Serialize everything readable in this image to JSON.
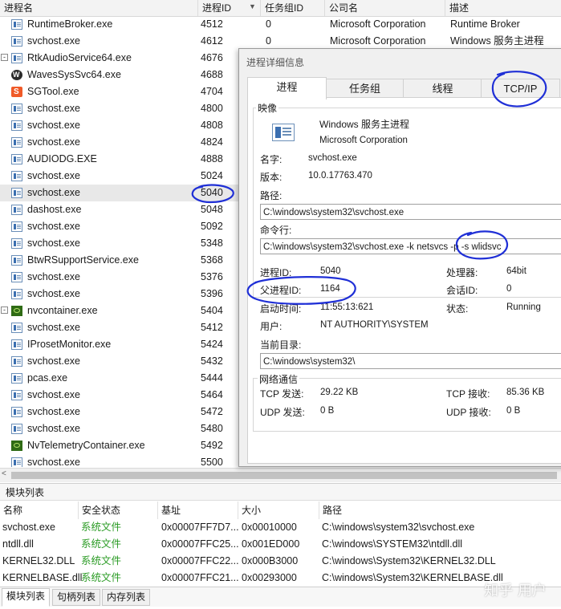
{
  "process_table": {
    "columns": [
      "进程名",
      "进程ID",
      "任务组ID",
      "公司名",
      "描述"
    ],
    "rows": [
      {
        "name": "RuntimeBroker.exe",
        "pid": "4512",
        "jid": "0",
        "company": "Microsoft Corporation",
        "desc": "Runtime Broker",
        "icon": "generic-exe-icon",
        "expand": ""
      },
      {
        "name": "svchost.exe",
        "pid": "4612",
        "jid": "0",
        "company": "Microsoft Corporation",
        "desc": "Windows 服务主进程",
        "icon": "generic-exe-icon",
        "expand": ""
      },
      {
        "name": "RtkAudioService64.exe",
        "pid": "4676",
        "jid": "",
        "company": "",
        "desc": "",
        "icon": "generic-exe-icon",
        "expand": "-"
      },
      {
        "name": "WavesSysSvc64.exe",
        "pid": "4688",
        "jid": "",
        "company": "",
        "desc": "",
        "icon": "waves-icon",
        "expand": ""
      },
      {
        "name": "SGTool.exe",
        "pid": "4704",
        "jid": "",
        "company": "",
        "desc": "",
        "icon": "sogou-icon",
        "expand": ""
      },
      {
        "name": "svchost.exe",
        "pid": "4800",
        "jid": "",
        "company": "",
        "desc": "",
        "icon": "generic-exe-icon",
        "expand": ""
      },
      {
        "name": "svchost.exe",
        "pid": "4808",
        "jid": "",
        "company": "",
        "desc": "",
        "icon": "generic-exe-icon",
        "expand": ""
      },
      {
        "name": "svchost.exe",
        "pid": "4824",
        "jid": "",
        "company": "",
        "desc": "",
        "icon": "generic-exe-icon",
        "expand": ""
      },
      {
        "name": "AUDIODG.EXE",
        "pid": "4888",
        "jid": "",
        "company": "",
        "desc": "",
        "icon": "generic-exe-icon",
        "expand": ""
      },
      {
        "name": "svchost.exe",
        "pid": "5024",
        "jid": "",
        "company": "",
        "desc": "",
        "icon": "generic-exe-icon",
        "expand": ""
      },
      {
        "name": "svchost.exe",
        "pid": "5040",
        "jid": "",
        "company": "",
        "desc": "",
        "icon": "generic-exe-icon",
        "expand": "",
        "selected": true
      },
      {
        "name": "dashost.exe",
        "pid": "5048",
        "jid": "",
        "company": "",
        "desc": "",
        "icon": "generic-exe-icon",
        "expand": ""
      },
      {
        "name": "svchost.exe",
        "pid": "5092",
        "jid": "",
        "company": "",
        "desc": "",
        "icon": "generic-exe-icon",
        "expand": ""
      },
      {
        "name": "svchost.exe",
        "pid": "5348",
        "jid": "",
        "company": "",
        "desc": "",
        "icon": "generic-exe-icon",
        "expand": ""
      },
      {
        "name": "BtwRSupportService.exe",
        "pid": "5368",
        "jid": "",
        "company": "",
        "desc": "",
        "icon": "generic-exe-icon",
        "expand": ""
      },
      {
        "name": "svchost.exe",
        "pid": "5376",
        "jid": "",
        "company": "",
        "desc": "",
        "icon": "generic-exe-icon",
        "expand": ""
      },
      {
        "name": "svchost.exe",
        "pid": "5396",
        "jid": "",
        "company": "",
        "desc": "",
        "icon": "generic-exe-icon",
        "expand": ""
      },
      {
        "name": "nvcontainer.exe",
        "pid": "5404",
        "jid": "",
        "company": "",
        "desc": "",
        "icon": "nvidia-icon",
        "expand": "-"
      },
      {
        "name": "svchost.exe",
        "pid": "5412",
        "jid": "",
        "company": "",
        "desc": "",
        "icon": "generic-exe-icon",
        "expand": ""
      },
      {
        "name": "IProsetMonitor.exe",
        "pid": "5424",
        "jid": "",
        "company": "",
        "desc": "",
        "icon": "generic-exe-icon",
        "expand": ""
      },
      {
        "name": "svchost.exe",
        "pid": "5432",
        "jid": "",
        "company": "",
        "desc": "",
        "icon": "generic-exe-icon",
        "expand": ""
      },
      {
        "name": "pcas.exe",
        "pid": "5444",
        "jid": "",
        "company": "",
        "desc": "",
        "icon": "generic-exe-icon",
        "expand": ""
      },
      {
        "name": "svchost.exe",
        "pid": "5464",
        "jid": "",
        "company": "",
        "desc": "",
        "icon": "generic-exe-icon",
        "expand": ""
      },
      {
        "name": "svchost.exe",
        "pid": "5472",
        "jid": "",
        "company": "",
        "desc": "",
        "icon": "generic-exe-icon",
        "expand": ""
      },
      {
        "name": "svchost.exe",
        "pid": "5480",
        "jid": "",
        "company": "",
        "desc": "",
        "icon": "generic-exe-icon",
        "expand": ""
      },
      {
        "name": "NvTelemetryContainer.exe",
        "pid": "5492",
        "jid": "",
        "company": "",
        "desc": "",
        "icon": "nvidia-icon",
        "expand": ""
      },
      {
        "name": "svchost.exe",
        "pid": "5500",
        "jid": "",
        "company": "",
        "desc": "",
        "icon": "generic-exe-icon",
        "expand": ""
      }
    ]
  },
  "dialog": {
    "title": "进程详细信息",
    "tabs": [
      "进程",
      "任务组",
      "线程",
      "TCP/IP"
    ],
    "image_group": "映像",
    "description": "Windows 服务主进程",
    "company": "Microsoft Corporation",
    "name_label": "名字:",
    "name_value": "svchost.exe",
    "version_label": "版本:",
    "version_value": "10.0.17763.470",
    "path_label": "路径:",
    "path_value": "C:\\windows\\system32\\svchost.exe",
    "cmd_label": "命令行:",
    "cmd_value": "C:\\windows\\system32\\svchost.exe -k netsvcs -p -s wlidsvc",
    "pid_label": "进程ID:",
    "pid_value": "5040",
    "ppid_label": "父进程ID:",
    "ppid_value": "1164",
    "start_label": "启动时间:",
    "start_value": "11:55:13:621",
    "user_label": "用户:",
    "user_value": "NT AUTHORITY\\SYSTEM",
    "arch_label": "处理器:",
    "arch_value": "64bit",
    "session_label": "会话ID:",
    "session_value": "0",
    "state_label": "状态:",
    "state_value": "Running",
    "cwd_label": "当前目录:",
    "cwd_value": "C:\\windows\\system32\\",
    "net_group": "网络通信",
    "tcp_send_label": "TCP 发送:",
    "tcp_send_value": "29.22 KB",
    "tcp_recv_label": "TCP 接收:",
    "tcp_recv_value": "85.36 KB",
    "udp_send_label": "UDP 发送:",
    "udp_send_value": "0 B",
    "udp_recv_label": "UDP 接收:",
    "udp_recv_value": "0 B"
  },
  "modules": {
    "title": "模块列表",
    "columns": [
      "名称",
      "安全状态",
      "基址",
      "大小",
      "路径"
    ],
    "rows": [
      {
        "name": "svchost.exe",
        "status": "系统文件",
        "base": "0x00007FF7D7...",
        "size": "0x00010000",
        "path": "C:\\windows\\system32\\svchost.exe"
      },
      {
        "name": "ntdll.dll",
        "status": "系统文件",
        "base": "0x00007FFC25...",
        "size": "0x001ED000",
        "path": "C:\\windows\\SYSTEM32\\ntdll.dll"
      },
      {
        "name": "KERNEL32.DLL",
        "status": "系统文件",
        "base": "0x00007FFC22...",
        "size": "0x000B3000",
        "path": "C:\\windows\\System32\\KERNEL32.DLL"
      },
      {
        "name": "KERNELBASE.dll",
        "status": "系统文件",
        "base": "0x00007FFC21...",
        "size": "0x00293000",
        "path": "C:\\windows\\System32\\KERNELBASE.dll"
      }
    ],
    "status_color": "#2a9b24"
  },
  "bottom_tabs": [
    "模块列表",
    "句柄列表",
    "内存列表"
  ],
  "watermark": "知乎 用户",
  "annotation_color": "#1f2fd6"
}
